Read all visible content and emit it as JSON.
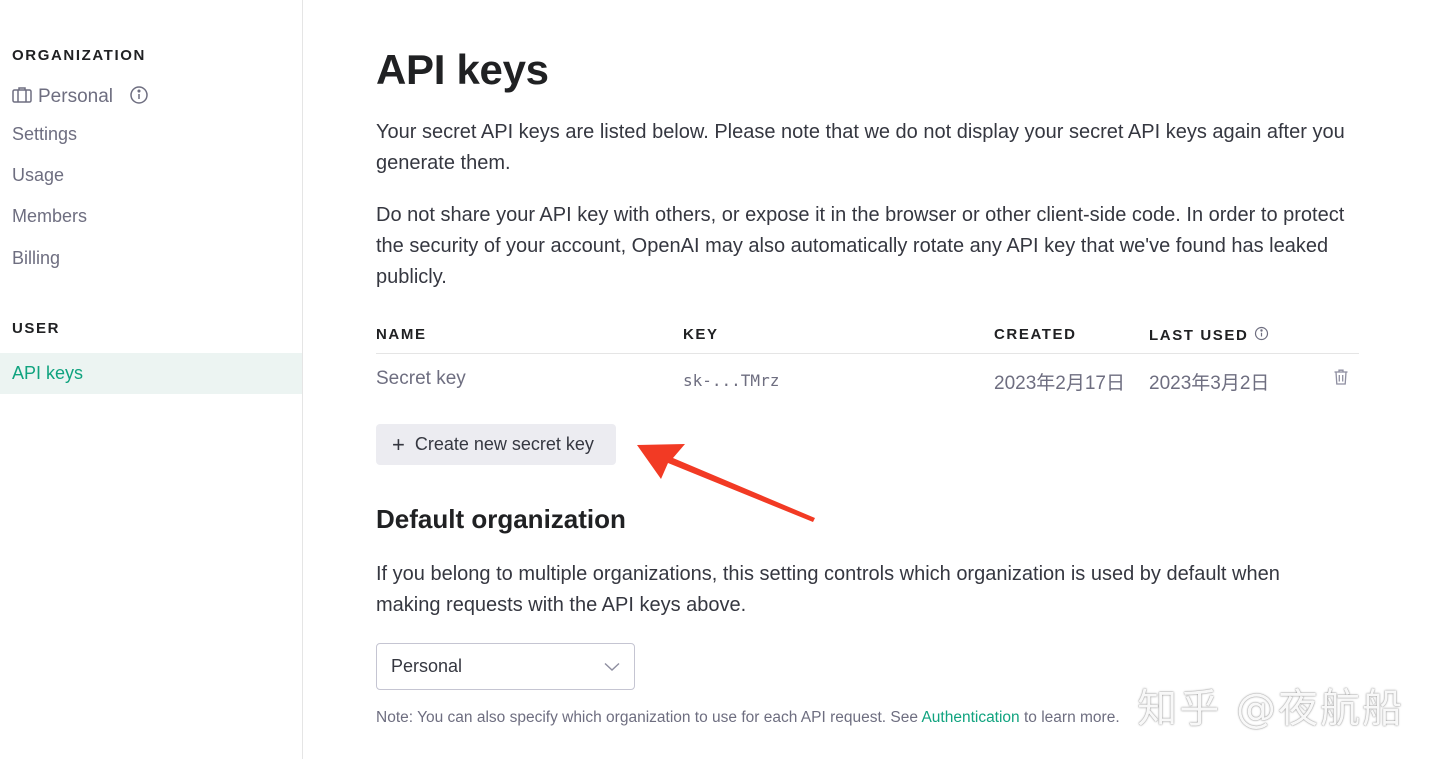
{
  "sidebar": {
    "org_heading": "ORGANIZATION",
    "org_name": "Personal",
    "items": [
      {
        "label": "Settings"
      },
      {
        "label": "Usage"
      },
      {
        "label": "Members"
      },
      {
        "label": "Billing"
      }
    ],
    "user_heading": "USER",
    "active_item": "API keys"
  },
  "main": {
    "title": "API keys",
    "intro_1": "Your secret API keys are listed below. Please note that we do not display your secret API keys again after you generate them.",
    "intro_2": "Do not share your API key with others, or expose it in the browser or other client-side code. In order to protect the security of your account, OpenAI may also automatically rotate any API key that we've found has leaked publicly.",
    "table": {
      "headers": {
        "name": "NAME",
        "key": "KEY",
        "created": "CREATED",
        "last_used": "LAST USED"
      },
      "rows": [
        {
          "name": "Secret key",
          "key": "sk-...TMrz",
          "created": "2023年2月17日",
          "last_used": "2023年3月2日"
        }
      ]
    },
    "create_button": {
      "icon": "+",
      "label": "Create new secret key"
    },
    "default_org": {
      "title": "Default organization",
      "description": "If you belong to multiple organizations, this setting controls which organization is used by default when making requests with the API keys above.",
      "selected": "Personal",
      "note_prefix": "Note: You can also specify which organization to use for each API request. See ",
      "note_link": "Authentication",
      "note_suffix": " to learn more."
    }
  },
  "annotation": {
    "arrow_color": "#f23a24"
  },
  "watermark": "知乎 @夜航船",
  "colors": {
    "accent": "#10a37f",
    "active_bg": "#ecf4f2",
    "button_bg": "#ececf1"
  }
}
